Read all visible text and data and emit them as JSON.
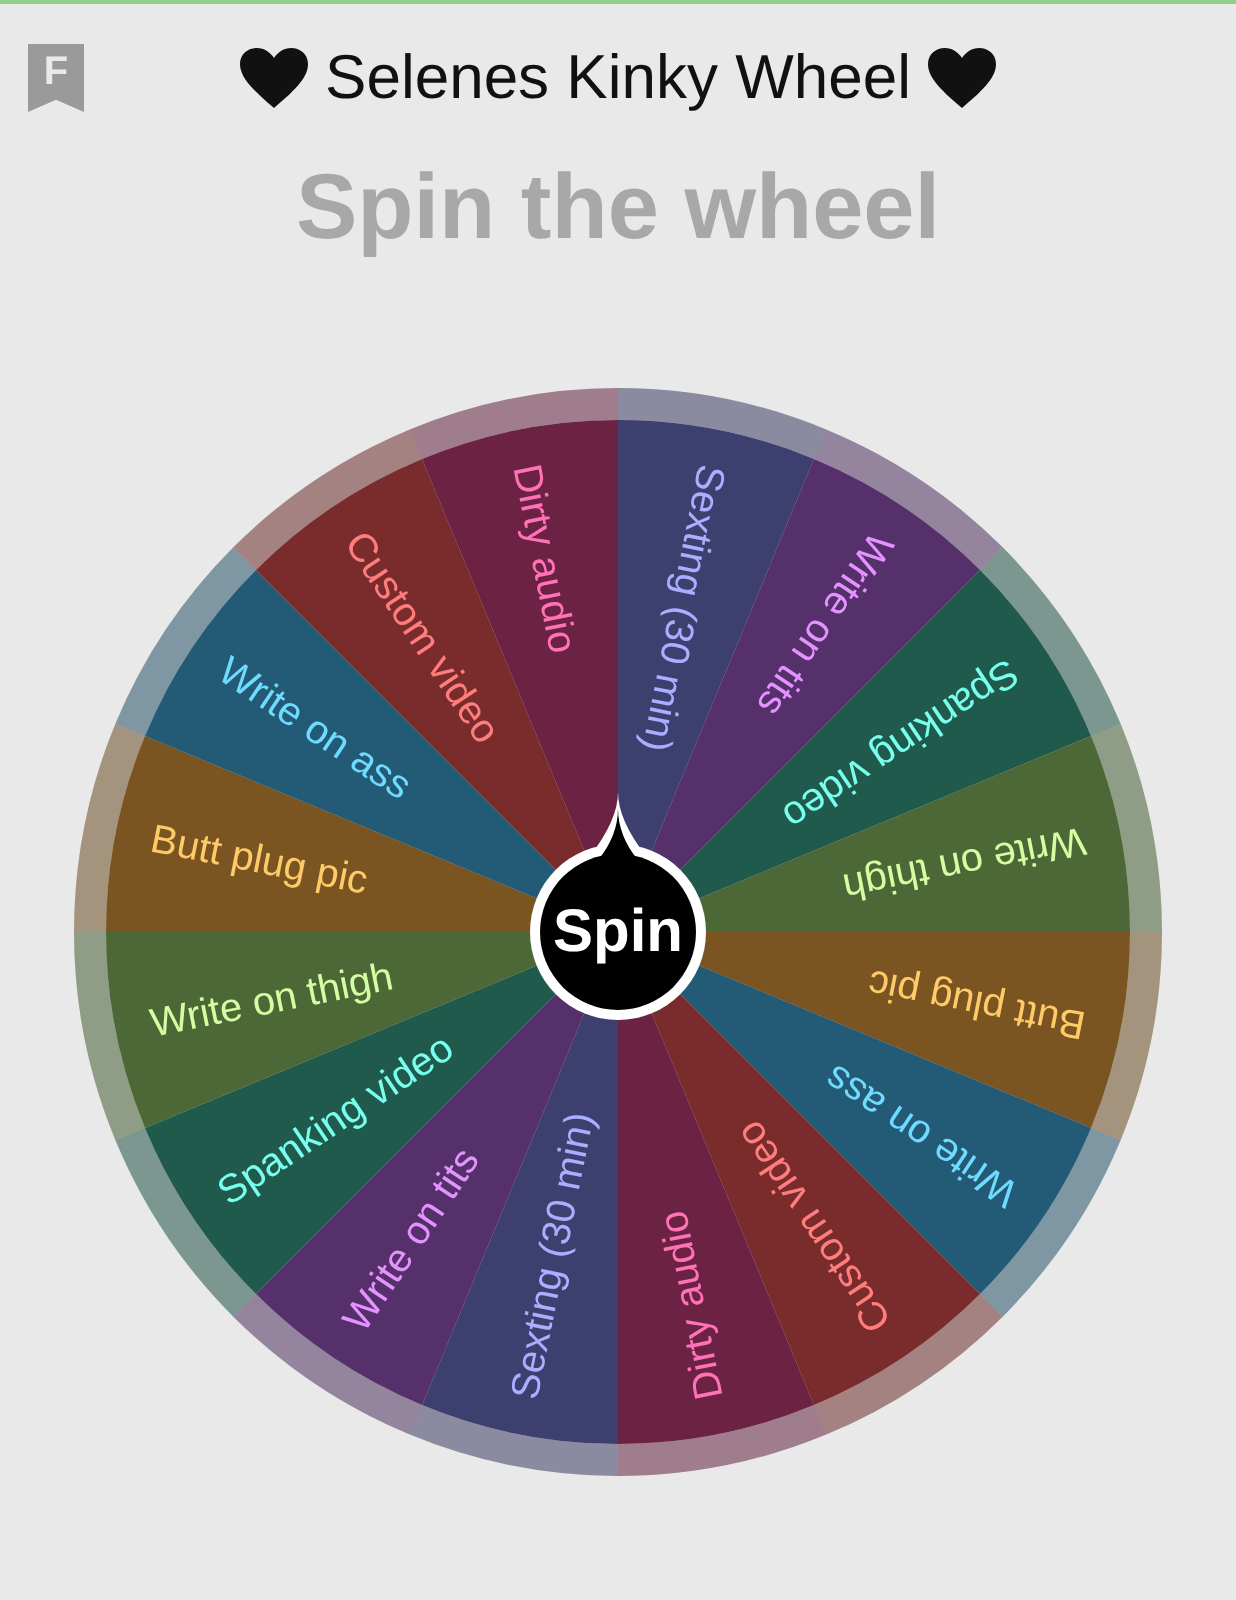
{
  "header": {
    "logo": "F",
    "title": "Selenes Kinky Wheel"
  },
  "heading": "Spin the wheel",
  "wheel": {
    "button": "Spin",
    "segments": [
      {
        "label": "Sexting (30 min)",
        "color": "#3d3f6e"
      },
      {
        "label": "Write on tits",
        "color": "#55306a"
      },
      {
        "label": "Spanking video",
        "color": "#1f5a4c"
      },
      {
        "label": "Write on thigh",
        "color": "#4c6836"
      },
      {
        "label": "Butt plug pic",
        "color": "#7a5522"
      },
      {
        "label": "Write on ass",
        "color": "#235a76"
      },
      {
        "label": "Custom video",
        "color": "#7a2c2c"
      },
      {
        "label": "Dirty audio",
        "color": "#6c2242"
      },
      {
        "label": "Sexting (30 min)",
        "color": "#3d3f6e"
      },
      {
        "label": "Write on tits",
        "color": "#55306a"
      },
      {
        "label": "Spanking video",
        "color": "#1f5a4c"
      },
      {
        "label": "Write on thigh",
        "color": "#4c6836"
      },
      {
        "label": "Butt plug pic",
        "color": "#7a5522"
      },
      {
        "label": "Write on ass",
        "color": "#235a76"
      },
      {
        "label": "Custom video",
        "color": "#7a2c2c"
      },
      {
        "label": "Dirty audio",
        "color": "#6c2242"
      }
    ]
  }
}
